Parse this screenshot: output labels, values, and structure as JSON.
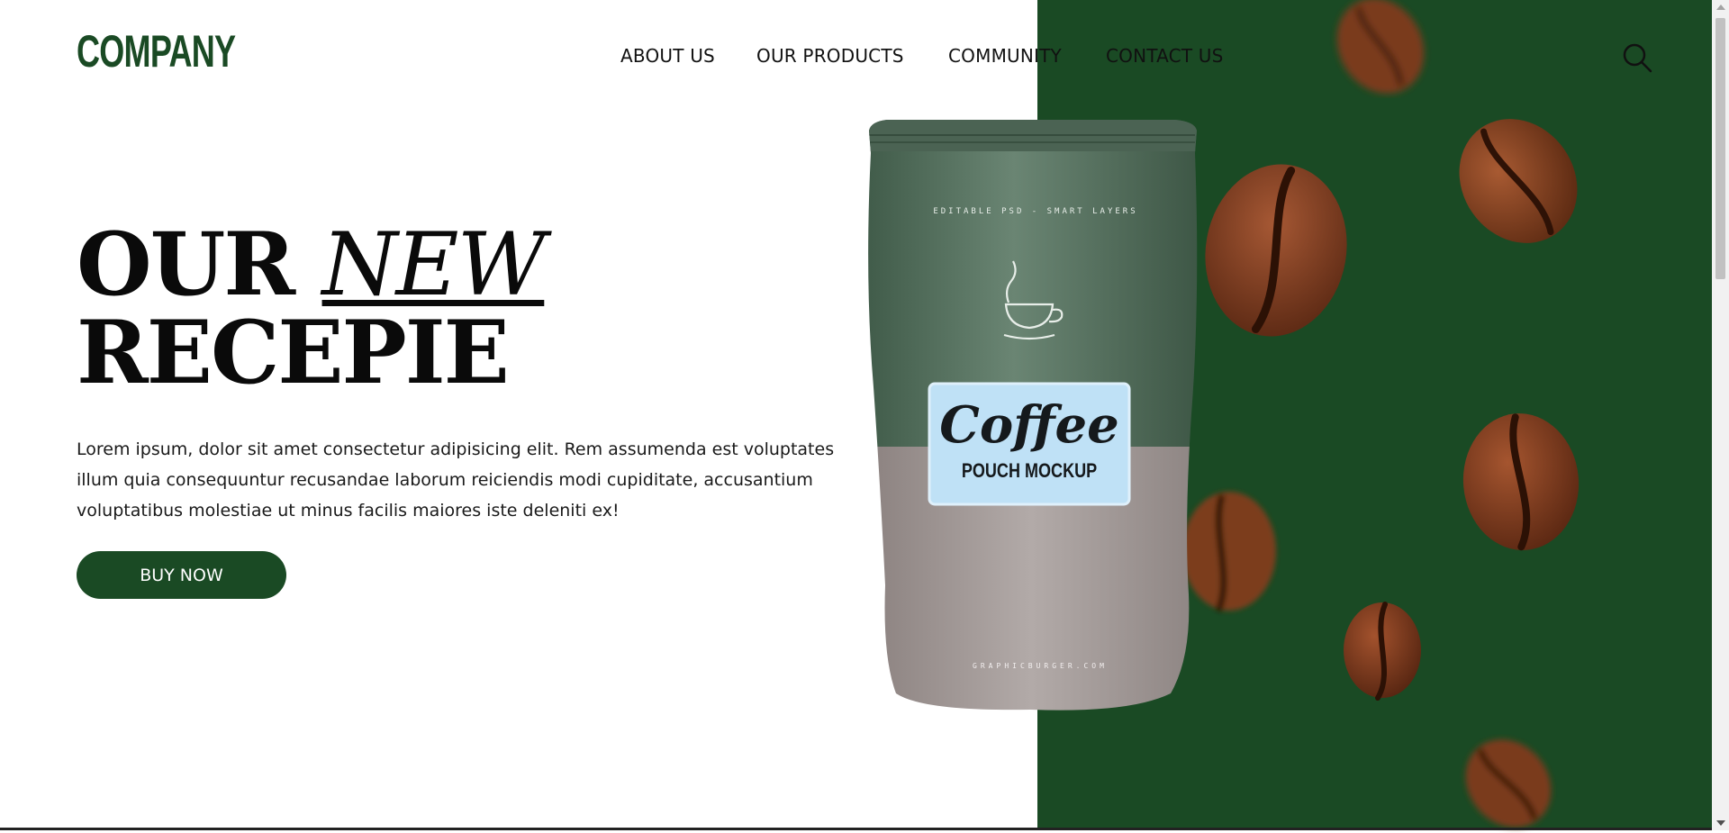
{
  "brand": {
    "logo": "COMPANY"
  },
  "nav": {
    "items": [
      {
        "label": "ABOUT US"
      },
      {
        "label": "OUR PRODUCTS"
      },
      {
        "label": "COMMUNITY"
      },
      {
        "label": "CONTACT US"
      }
    ],
    "search_icon": "search-icon"
  },
  "hero": {
    "title_word_1": "OUR",
    "title_word_2": "NEW",
    "title_line_2": "RECEPIE",
    "description": "Lorem ipsum, dolor sit amet consectetur adipisicing elit. Rem assumenda est voluptates illum quia consequuntur recusandae laborum reiciendis modi cupiditate, accusantium voluptatibus molestiae ut minus facilis maiores iste deleniti ex!",
    "cta_label": "BUY NOW"
  },
  "product": {
    "label_title": "Coffee",
    "label_subtitle": "POUCH MOCKUP",
    "arc_text": "EDITABLE PSD - SMART LAYERS",
    "bottom_text": "GRAPHICBURGER.COM"
  },
  "colors": {
    "brand_green": "#1a4a24",
    "pouch_top": "#54705e",
    "pouch_bottom": "#a49b98",
    "label_blue": "#bfe1f6",
    "bean": "#7a3b1d"
  }
}
